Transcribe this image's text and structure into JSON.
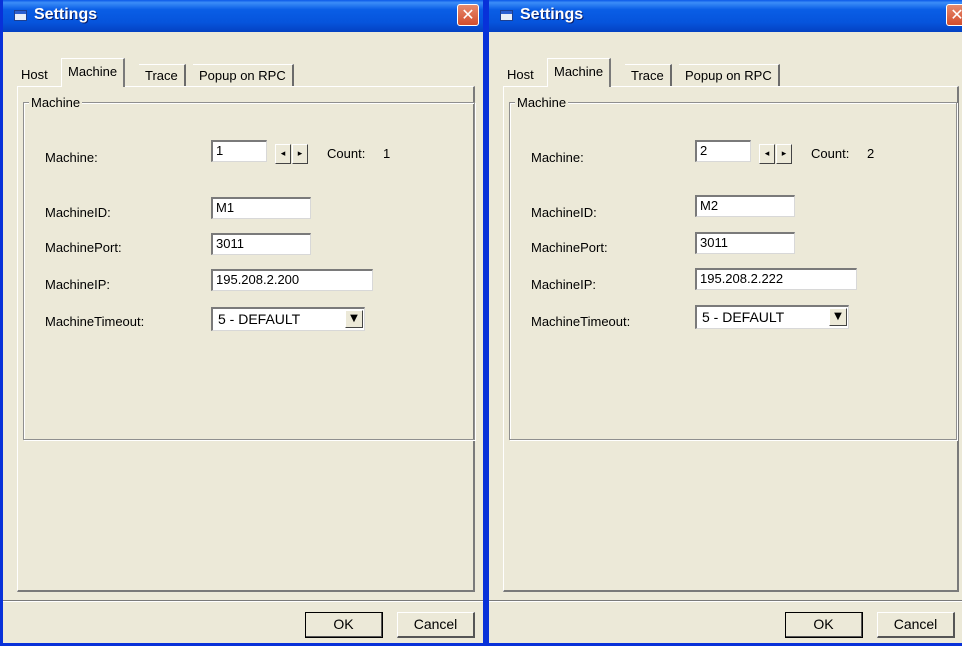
{
  "windows": [
    {
      "title": "Settings",
      "close_glyph": "✕",
      "tabs": [
        "Host",
        "Machine",
        "Trace",
        "Popup on RPC"
      ],
      "active_tab": "Machine",
      "group_title": "Machine",
      "machine_label": "Machine:",
      "machine_value": "1",
      "spin_left": "◂",
      "spin_right": "▸",
      "count_label": "Count:",
      "count_value": "1",
      "machine_id_label": "MachineID:",
      "machine_id_value": "M1",
      "machine_port_label": "MachinePort:",
      "machine_port_value": "3011",
      "machine_ip_label": "MachineIP:",
      "machine_ip_value": "195.208.2.200",
      "machine_timeout_label": "MachineTimeout:",
      "machine_timeout_value": "5 - DEFAULT",
      "dropdown_glyph": "▼",
      "ok_label": "OK",
      "cancel_label": "Cancel"
    },
    {
      "title": "Settings",
      "close_glyph": "✕",
      "tabs": [
        "Host",
        "Machine",
        "Trace",
        "Popup on RPC"
      ],
      "active_tab": "Machine",
      "group_title": "Machine",
      "machine_label": "Machine:",
      "machine_value": "2",
      "spin_left": "◂",
      "spin_right": "▸",
      "count_label": "Count:",
      "count_value": "2",
      "machine_id_label": "MachineID:",
      "machine_id_value": "M2",
      "machine_port_label": "MachinePort:",
      "machine_port_value": "3011",
      "machine_ip_label": "MachineIP:",
      "machine_ip_value": "195.208.2.222",
      "machine_timeout_label": "MachineTimeout:",
      "machine_timeout_value": "5 - DEFAULT",
      "dropdown_glyph": "▼",
      "ok_label": "OK",
      "cancel_label": "Cancel"
    }
  ],
  "colors": {
    "titlebar_blue": "#0654dc",
    "window_border": "#0831d9",
    "dialog_face": "#ece9d8",
    "close_red": "#d34d2d"
  },
  "icons": {
    "window_icon": "window-icon",
    "close": "close-icon",
    "spin_left": "arrow-left-icon",
    "spin_right": "arrow-right-icon",
    "dropdown": "chevron-down-icon"
  }
}
